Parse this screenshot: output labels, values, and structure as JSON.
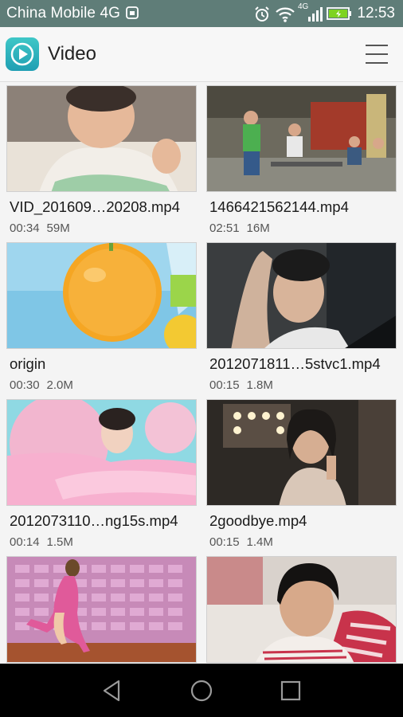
{
  "status_bar": {
    "carrier": "China Mobile 4G",
    "network_label": "4G",
    "time": "12:53",
    "color": "#5f7d78"
  },
  "app_bar": {
    "title": "Video",
    "accent": "#2cb3c0"
  },
  "videos": [
    {
      "name": "VID_201609…20208.mp4",
      "duration": "00:34",
      "size": "59M"
    },
    {
      "name": "1466421562144.mp4",
      "duration": "02:51",
      "size": "16M"
    },
    {
      "name": "origin",
      "duration": "00:30",
      "size": "2.0M"
    },
    {
      "name": "2012071811…5stvc1.mp4",
      "duration": "00:15",
      "size": "1.8M"
    },
    {
      "name": "2012073110…ng15s.mp4",
      "duration": "00:14",
      "size": "1.5M"
    },
    {
      "name": "2goodbye.mp4",
      "duration": "00:15",
      "size": "1.4M"
    },
    {
      "name": "",
      "duration": "",
      "size": ""
    },
    {
      "name": "",
      "duration": "",
      "size": ""
    }
  ],
  "nav_icons": [
    "back-icon",
    "home-icon",
    "recents-icon"
  ]
}
